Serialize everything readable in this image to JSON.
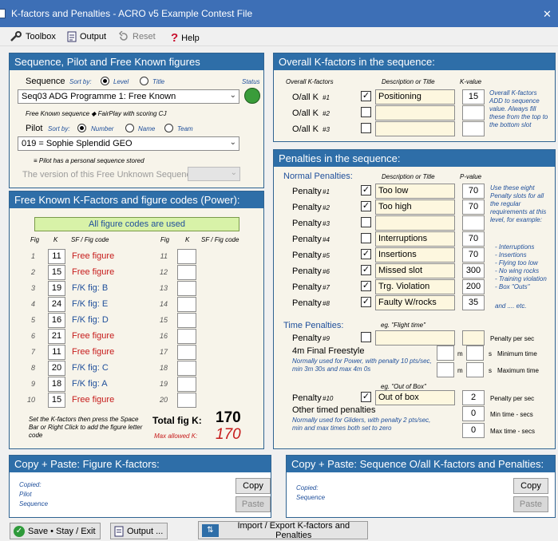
{
  "window": {
    "title": "K-factors and Penalties - ACRO v5 Example Contest File",
    "close": "✕"
  },
  "toolbar": {
    "toolbox": "Toolbox",
    "output": "Output",
    "reset": "Reset",
    "help": "Help"
  },
  "seq": {
    "head": "Sequence, Pilot and Free Known figures",
    "sequence_label": "Sequence",
    "sort_by": "Sort by:",
    "level": "Level",
    "title_opt": "Title",
    "status": "Status",
    "combo": "Seq03  ADG  Programme 1: Free Known",
    "note": "Free Known sequence  ◆  FairPlay with scoring CJ",
    "pilot_label": "Pilot",
    "number": "Number",
    "name": "Name",
    "team": "Team",
    "pilot_combo": "019 = Sophie Splendid  GEO",
    "pilot_note": "≡  Pilot has a personal sequence stored",
    "version": "The version of this Free Unknown Sequence"
  },
  "figs": {
    "head": "Free Known K-Factors and figure codes (Power):",
    "banner": "All figure codes are used",
    "col_fig": "Fig",
    "col_k": "K",
    "col_sf": "SF / Fig code",
    "left": [
      {
        "n": "1",
        "k": "11",
        "code": "Free figure",
        "red": true
      },
      {
        "n": "2",
        "k": "15",
        "code": "Free figure",
        "red": true
      },
      {
        "n": "3",
        "k": "19",
        "code": "F/K fig:  B",
        "red": false
      },
      {
        "n": "4",
        "k": "24",
        "code": "F/K fig:  E",
        "red": false
      },
      {
        "n": "5",
        "k": "16",
        "code": "F/K fig:  D",
        "red": false
      },
      {
        "n": "6",
        "k": "21",
        "code": "Free figure",
        "red": true
      },
      {
        "n": "7",
        "k": "11",
        "code": "Free figure",
        "red": true
      },
      {
        "n": "8",
        "k": "20",
        "code": "F/K fig:  C",
        "red": false
      },
      {
        "n": "9",
        "k": "18",
        "code": "F/K fig:  A",
        "red": false
      },
      {
        "n": "10",
        "k": "15",
        "code": "Free figure",
        "red": true
      }
    ],
    "right": [
      "11",
      "12",
      "13",
      "14",
      "15",
      "16",
      "17",
      "18",
      "19",
      "20"
    ],
    "hint": "Set the K-factors then press the Space Bar or Right Click to add the figure letter code",
    "total_label": "Total fig K:",
    "total": "170",
    "max_label": "Max allowed K:",
    "max": "170"
  },
  "overall": {
    "head": "Overall K-factors in the sequence:",
    "col1": "Overall K-factors",
    "col2": "Description or Title",
    "col3": "K-value",
    "rows": [
      {
        "label": "O/all K",
        "n": "#1",
        "checked": true,
        "desc": "Positioning",
        "val": "15"
      },
      {
        "label": "O/all K",
        "n": "#2",
        "checked": false,
        "desc": "",
        "val": ""
      },
      {
        "label": "O/all K",
        "n": "#3",
        "checked": false,
        "desc": "",
        "val": ""
      }
    ],
    "note": "Overall K-factors ADD to sequence value. Always fill these from the top to the bottom slot"
  },
  "pen": {
    "head": "Penalties in the sequence:",
    "normal": "Normal Penalties:",
    "col2": "Description or Title",
    "col3": "P-value",
    "rows": [
      {
        "label": "Penalty",
        "n": "#1",
        "checked": true,
        "desc": "Too low",
        "val": "70"
      },
      {
        "label": "Penalty",
        "n": "#2",
        "checked": true,
        "desc": "Too high",
        "val": "70"
      },
      {
        "label": "Penalty",
        "n": "#3",
        "checked": false,
        "desc": "",
        "val": ""
      },
      {
        "label": "Penalty",
        "n": "#4",
        "checked": false,
        "desc": "Interruptions",
        "val": "70"
      },
      {
        "label": "Penalty",
        "n": "#5",
        "checked": true,
        "desc": "Insertions",
        "val": "70"
      },
      {
        "label": "Penalty",
        "n": "#6",
        "checked": true,
        "desc": "Missed slot",
        "val": "300"
      },
      {
        "label": "Penalty",
        "n": "#7",
        "checked": true,
        "desc": "Trg. Violation",
        "val": "200"
      },
      {
        "label": "Penalty",
        "n": "#8",
        "checked": true,
        "desc": "Faulty W/rocks",
        "val": "35"
      }
    ],
    "side_note": "Use these eight Penalty slots for all the regular requirements at this level, for example:",
    "examples": [
      "- Interruptions",
      "- Insertions",
      "- Flying too low",
      "- No wing rocks",
      "- Training violation",
      "- Box \"Outs\""
    ],
    "etc": "and .... etc.",
    "time": "Time Penalties:",
    "eg1": "eg. \"Flight time\"",
    "p9": {
      "label": "Penalty",
      "n": "#9"
    },
    "per_sec": "Penalty per sec",
    "final": "4m Final Freestyle",
    "final_note": "Normally used for Power, with penalty 10 pts/sec, min 3m 30s and max 4m 0s",
    "m": "m",
    "s": "s",
    "min_time": "Minimum time",
    "max_time": "Maximum time",
    "eg2": "eg. \"Out of Box\"",
    "p10": {
      "label": "Penalty",
      "n": "#10",
      "desc": "Out of box",
      "val": "2",
      "min": "0",
      "max": "0"
    },
    "other": "Other timed penalties",
    "other_note": "Normally used for Gliders, with penalty 2 pts/sec, min and max times both set to zero",
    "per_sec2": "Penalty per sec",
    "min_secs": "Min time - secs",
    "max_secs": "Max time - secs"
  },
  "copy1": {
    "head": "Copy + Paste:  Figure K-factors:",
    "copied": "Copied:",
    "pilot": "Pilot",
    "sequence": "Sequence",
    "copy": "Copy",
    "paste": "Paste"
  },
  "copy2": {
    "head": "Copy + Paste:  Sequence O/all K-factors and Penalties:",
    "copied": "Copied:",
    "sequence": "Sequence",
    "copy": "Copy",
    "paste": "Paste"
  },
  "bottom": {
    "save": "Save • Stay / Exit",
    "output": "Output ...",
    "import": "Import / Export K-factors and Penalties"
  }
}
